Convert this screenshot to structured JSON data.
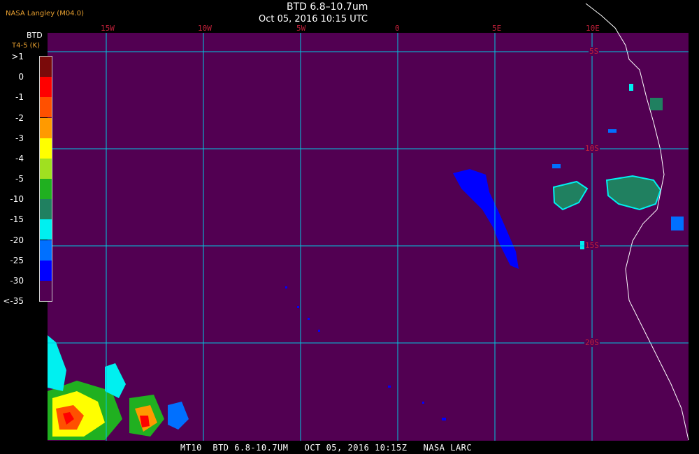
{
  "header": {
    "source": "NASA Langley (M04.0)",
    "title": "BTD 6.8–10.7um",
    "subtitle": "Oct 05, 2016 10:15 UTC"
  },
  "legend": {
    "title": "BTD",
    "unit_label": "T4-5 (K)",
    "ticks": [
      ">1",
      "0",
      "-1",
      "-2",
      "-3",
      "-4",
      "-5",
      "-10",
      "-15",
      "-20",
      "-25",
      "-30",
      "<-35"
    ],
    "colors": [
      "#7a0a0a",
      "#ff0000",
      "#ff5000",
      "#ff9a00",
      "#ffff00",
      "#a0e020",
      "#20b020",
      "#208060",
      "#00f0f0",
      "#0070ff",
      "#0000ff",
      "#520052"
    ]
  },
  "map": {
    "background_color": "#520052",
    "grid_color": "#00c8e0",
    "label_color": "#c0203a",
    "lon_labels": [
      "15W",
      "10W",
      "5W",
      "0",
      "5E",
      "10E"
    ],
    "lat_labels": [
      "5S",
      "10S",
      "15S",
      "20S"
    ]
  },
  "footer": {
    "text": "MT10  BTD 6.8-10.7UM   OCT 05, 2016 10:15Z   NASA LARC"
  }
}
